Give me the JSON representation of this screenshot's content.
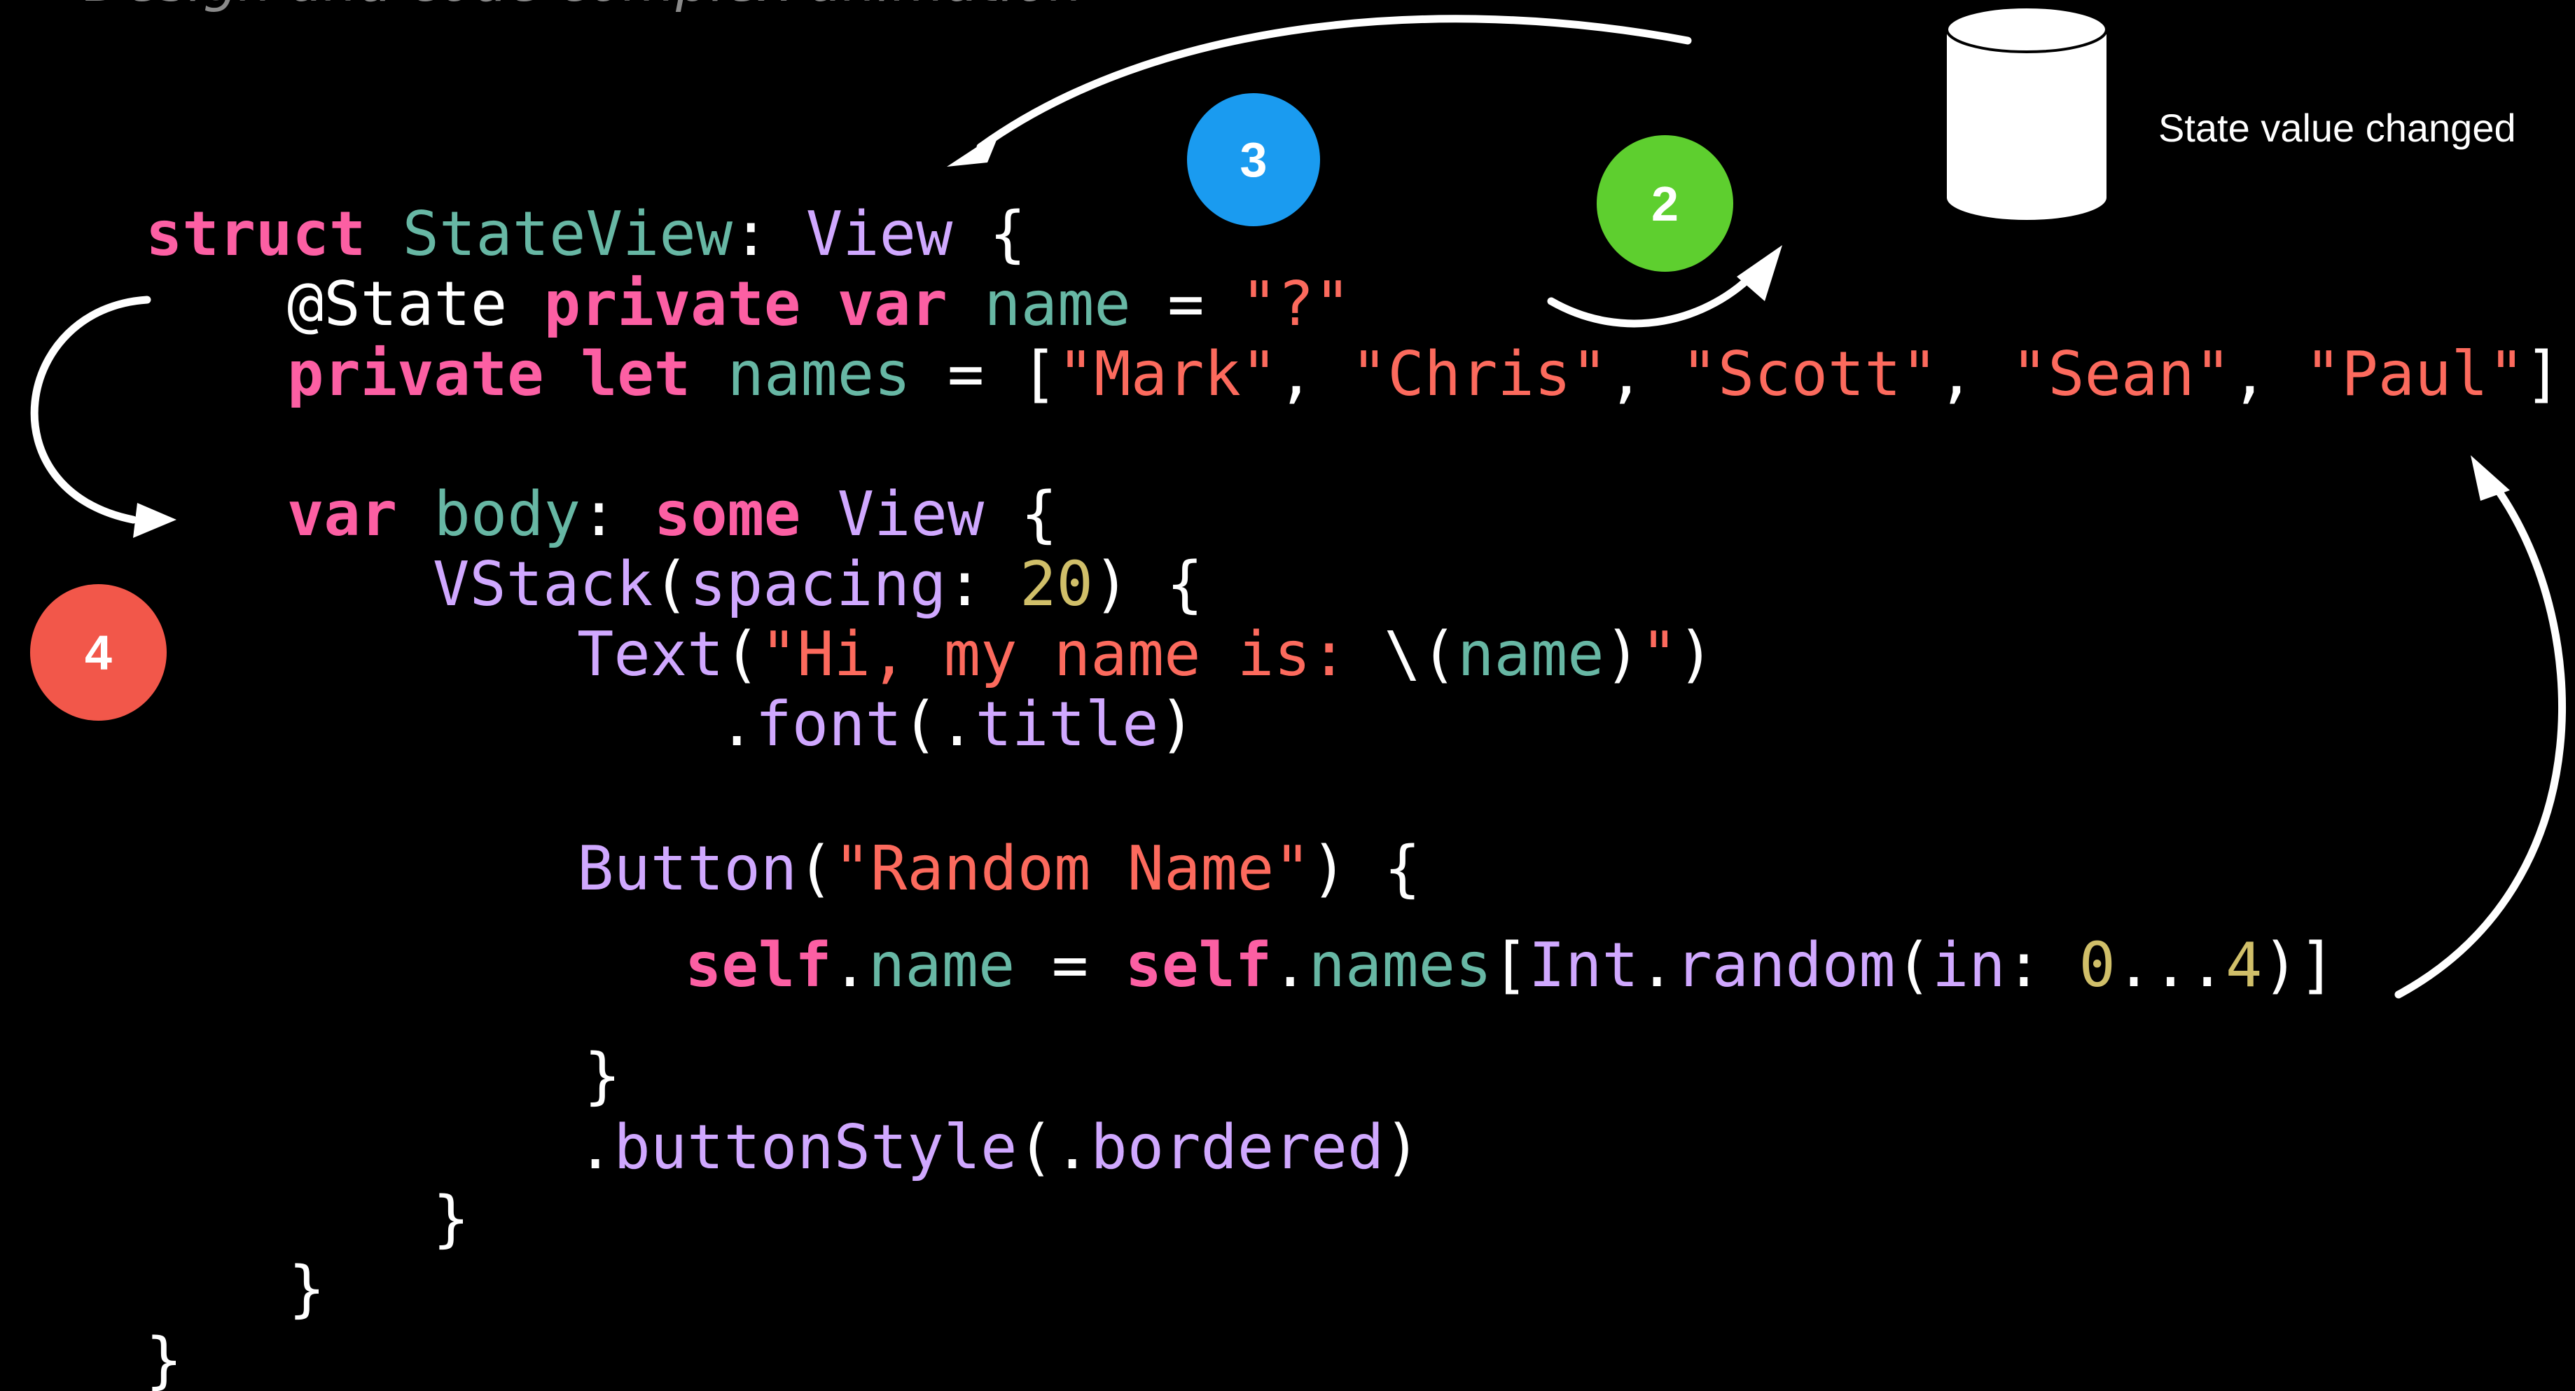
{
  "header_text": "Design and code complex animation",
  "state_label": "State value changed",
  "badges": [
    {
      "label": "3",
      "color": "#1a9bf0"
    },
    {
      "label": "2",
      "color": "#5ecf2f"
    },
    {
      "label": "4",
      "color": "#f2574a"
    }
  ],
  "code": {
    "l1": {
      "kw": "struct",
      "type1": "StateView",
      "colon": ": ",
      "type2": "View",
      "brace": " {"
    },
    "l2": {
      "attr": "@State",
      "kw1": "private",
      "kw2": "var",
      "prop": "name",
      "eq": " = ",
      "str": "\"?\""
    },
    "l3": {
      "kw1": "private",
      "kw2": "let",
      "prop": "names",
      "eq": " = [",
      "s1": "\"Mark\"",
      "s2": "\"Chris\"",
      "s3": "\"Scott\"",
      "s4": "\"Sean\"",
      "s5": "\"Paul\"",
      "comma": ", ",
      "close": "]"
    },
    "l4": {
      "kw1": "var",
      "prop": "body",
      "colon": ": ",
      "kw2": "some",
      "type": "View",
      "brace": " {"
    },
    "l5": {
      "type": "VStack",
      "open": "(",
      "param": "spacing",
      "colon": ": ",
      "num": "20",
      "close": ") {"
    },
    "l6": {
      "type": "Text",
      "open": "(",
      "s1": "\"Hi, my name is: ",
      "interp_open": "\\(",
      "prop": "name",
      "interp_close": ")",
      "s2": "\"",
      "close": ")"
    },
    "l7": {
      "dot": ".",
      "method": "font",
      "open": "(.",
      "val": "title",
      "close": ")"
    },
    "l8": {
      "type": "Button",
      "open": "(",
      "str": "\"Random Name\"",
      "close": ") {"
    },
    "l9": {
      "kw1": "self",
      "dot1": ".",
      "prop1": "name",
      "eq": " = ",
      "kw2": "self",
      "dot2": ".",
      "prop2": "names",
      "open": "[",
      "type": "Int",
      "dot3": ".",
      "method": "random",
      "open2": "(",
      "param": "in",
      "colon": ": ",
      "n1": "0",
      "range": "...",
      "n2": "4",
      "close": ")]"
    },
    "l10": {
      "brace": "}"
    },
    "l11": {
      "dot": ".",
      "method": "buttonStyle",
      "open": "(.",
      "val": "bordered",
      "close": ")"
    },
    "l12": {
      "brace": "}"
    },
    "l13": {
      "brace": "}"
    },
    "l14": {
      "brace": "}"
    }
  }
}
